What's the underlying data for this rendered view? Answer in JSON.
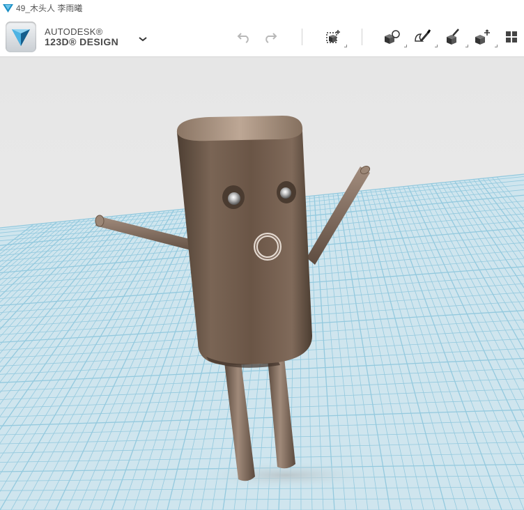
{
  "window": {
    "title": "49_木头人 李雨曦"
  },
  "brand": {
    "line1": "AUTODESK®",
    "line2": "123D® DESIGN"
  },
  "toolbar": {
    "buttons": [
      {
        "name": "undo-icon"
      },
      {
        "name": "redo-icon"
      },
      {
        "name": "primitives-icon"
      },
      {
        "name": "sketch-icon"
      },
      {
        "name": "construct-icon"
      },
      {
        "name": "modify-icon"
      },
      {
        "name": "pattern-icon"
      },
      {
        "name": "grouping-icon"
      }
    ]
  },
  "colors": {
    "grid_background": "#cfe4ec",
    "grid_line": "#8fc7dd",
    "model_wood": "#6e5a4a",
    "sky": "#e9e9e9"
  }
}
